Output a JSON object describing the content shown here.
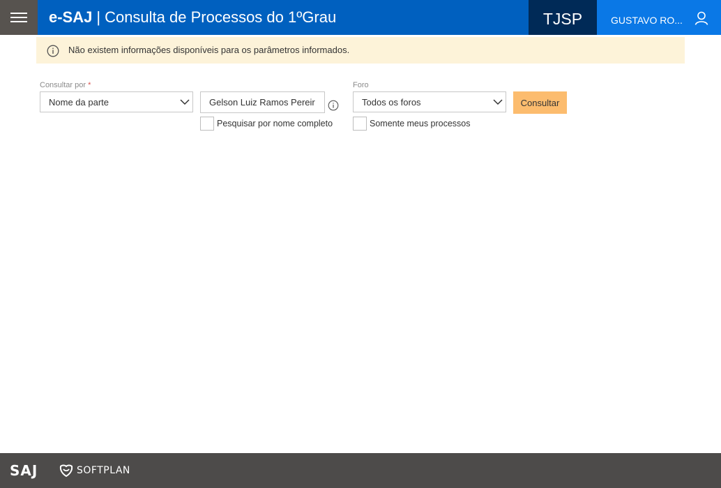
{
  "header": {
    "brand": "e-SAJ",
    "separator": "|",
    "subtitle": "Consulta de Processos do 1ºGrau",
    "court": "TJSP",
    "user_name": "GUSTAVO RO...",
    "menu_icon": "hamburger-icon",
    "user_icon": "user-icon"
  },
  "alert": {
    "icon": "info-circle-icon",
    "message": "Não existem informações disponíveis para os parâmetros informados."
  },
  "form": {
    "consultar_por_label": "Consultar por",
    "required_mark": "*",
    "consultar_por_value": "Nome da parte",
    "search_value": "Gelson Luiz Ramos Pereir",
    "full_name_label": "Pesquisar por nome completo",
    "full_name_checked": false,
    "foro_label": "Foro",
    "foro_value": "Todos os foros",
    "meus_processos_label": "Somente meus processos",
    "meus_processos_checked": false,
    "submit_label": "Consultar"
  },
  "footer": {
    "saj_logo_text": "SAJ",
    "softplan_text": "SOFTPLAN"
  },
  "colors": {
    "header_blue": "#0060bf",
    "court_navy": "#002a57",
    "user_blue": "#0a78e6",
    "menu_gray": "#57534f",
    "alert_bg": "#fdf3d9",
    "button_orange": "#fcbc6e",
    "footer_gray": "#4d4b4a"
  }
}
